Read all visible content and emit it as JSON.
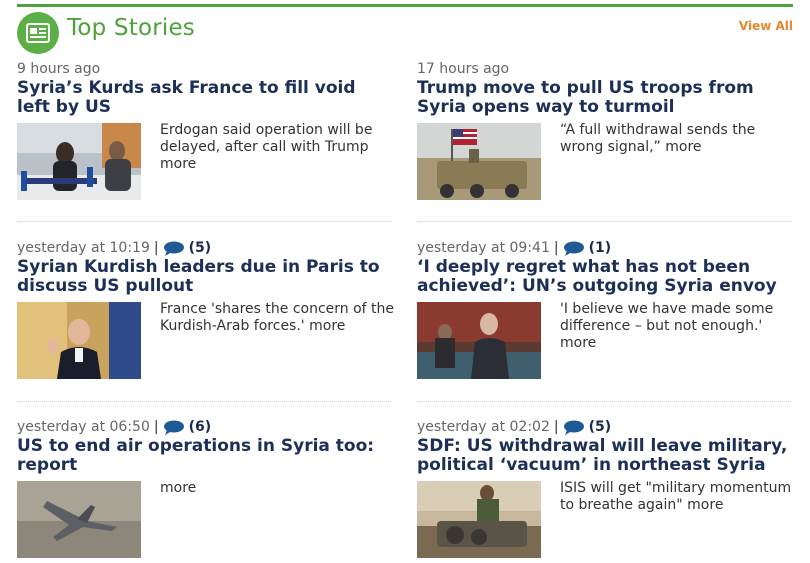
{
  "header": {
    "title": "Top Stories",
    "view_all": "View All"
  },
  "colors": {
    "accent_green": "#4ea23b",
    "view_all_orange": "#e8872d",
    "headline_navy": "#1c2f57"
  },
  "stories": [
    {
      "time": "9 hours ago",
      "comments": "",
      "headline": "Syria’s Kurds ask France to fill void left by US",
      "summary": "Erdogan said operation will be delayed, after call with Trump",
      "more": "more"
    },
    {
      "time": "17 hours ago",
      "comments": "",
      "headline": "Trump move to pull US troops from Syria opens way to turmoil",
      "summary": "“A full withdrawal sends the wrong signal,”",
      "more": "more"
    },
    {
      "time": "yesterday at 10:19",
      "comments": "(5)",
      "headline": "Syrian Kurdish leaders due in Paris to discuss US pullout",
      "summary": "France 'shares the concern of the Kurdish-Arab forces.'",
      "more": "more"
    },
    {
      "time": "yesterday at 09:41",
      "comments": "(1)",
      "headline": "‘I deeply regret what has not been achieved’: UN’s outgoing Syria envoy",
      "summary": "'I believe we have made some difference – but not enough.'",
      "more": "more"
    },
    {
      "time": "yesterday at 06:50",
      "comments": "(6)",
      "headline": "US to end air operations in Syria too: report",
      "summary": "",
      "more": "more"
    },
    {
      "time": "yesterday at 02:02",
      "comments": "(5)",
      "headline": "SDF: US withdrawal will leave military, political ‘vacuum’ in northeast Syria",
      "summary": "ISIS will get \"military momentum to breathe again\"",
      "more": "more"
    }
  ]
}
